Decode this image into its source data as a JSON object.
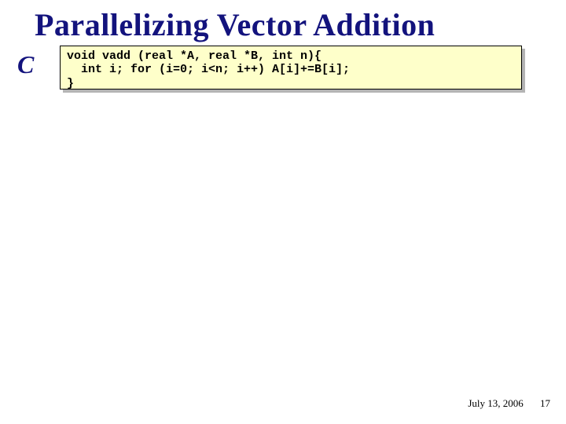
{
  "title": "Parallelizing Vector Addition",
  "lang_label": "C",
  "code": "void vadd (real *A, real *B, int n){\n  int i; for (i=0; i<n; i++) A[i]+=B[i];\n}",
  "footer": {
    "date": "July 13, 2006",
    "page": "17"
  }
}
